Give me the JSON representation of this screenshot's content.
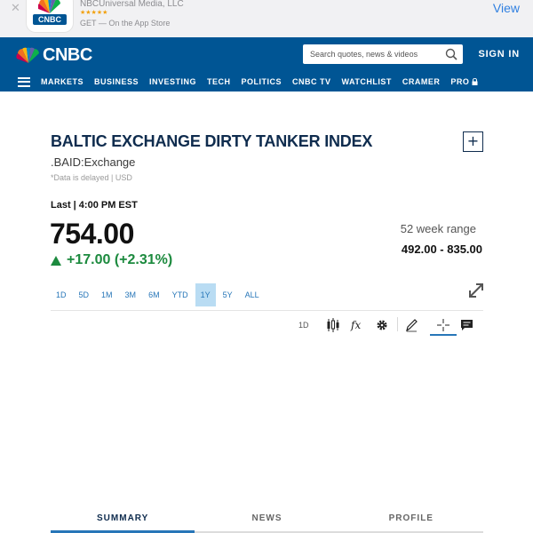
{
  "app_banner": {
    "close_icon": "close-icon",
    "app_icon_text": "CNBC",
    "publisher": "NBCUniversal Media, LLC",
    "stars": "★★★★★",
    "get_text": "GET — On the App Store",
    "view_label": "View"
  },
  "header": {
    "logo_text": "CNBC",
    "brand_color": "#005594",
    "search_placeholder": "Search quotes, news & videos",
    "sign_in_label": "SIGN IN",
    "nav_items": [
      "MARKETS",
      "BUSINESS",
      "INVESTING",
      "TECH",
      "POLITICS",
      "CNBC TV",
      "WATCHLIST",
      "CRAMER",
      "PRO"
    ]
  },
  "quote": {
    "title": "BALTIC EXCHANGE DIRTY TANKER INDEX",
    "symbol": ".BAID:Exchange",
    "delay_note": "*Data is delayed | USD",
    "last_label": "Last | 4:00 PM EST",
    "price": "754.00",
    "change": "+17.00 (+2.31%)",
    "change_color": "#1c8a3e",
    "week_range_label": "52 week range",
    "week_range": "492.00 - 835.00"
  },
  "chart_controls": {
    "ranges": [
      "1D",
      "5D",
      "1M",
      "3M",
      "6M",
      "YTD",
      "1Y",
      "5Y",
      "ALL"
    ],
    "active_range": "1Y",
    "interval": "1D",
    "toolbar_icons": [
      "candlestick-icon",
      "fx-icon",
      "gear-icon",
      "pencil-icon",
      "crosshair-icon",
      "comment-icon"
    ],
    "fx_label": "fx"
  },
  "tabs": {
    "items": [
      "SUMMARY",
      "NEWS",
      "PROFILE"
    ],
    "active": "SUMMARY"
  }
}
